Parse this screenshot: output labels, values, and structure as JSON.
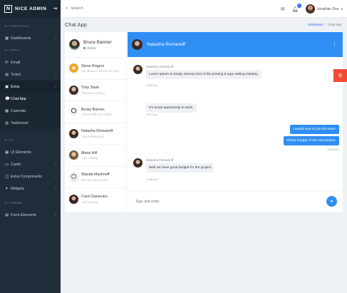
{
  "brand": {
    "name": "NICE ADMIN",
    "logo_letter": "N"
  },
  "sidebar": {
    "sections": {
      "personal": "PERSONAL",
      "apps": "APPS",
      "ui": "UI",
      "forms": "FORMS"
    },
    "items": {
      "dashboards": "Dashboards",
      "email": "Email",
      "ticket": "Ticket",
      "extra": "Extra",
      "chat_app": "Chat App",
      "calendar": "Calendar",
      "taskboard": "Taskboard",
      "ui_elements": "UI Elements",
      "cards": "Cards",
      "extra_components": "Extra Components",
      "widgets": "Widgets",
      "form_elements": "Form Elements"
    }
  },
  "topbar": {
    "search_placeholder": "Search",
    "notification_count": "3",
    "user_name": "Jonathan Doe"
  },
  "page": {
    "title": "Chat App",
    "breadcrumb": {
      "home": "Dashboard",
      "separator": "/",
      "current": "Chat App"
    }
  },
  "me": {
    "name": "Bruce Banner",
    "status": "Online"
  },
  "contacts": [
    {
      "name": "Steve Rogers",
      "message": "Hey Banner, Where are you?"
    },
    {
      "name": "Tony Stark",
      "message": "Thanos is coming"
    },
    {
      "name": "Bucky Barnes",
      "message": "I did not kill your family"
    },
    {
      "name": "Natasha Romanoff",
      "message": "I am multitasking"
    },
    {
      "name": "Maria Hill",
      "message": "I am coming"
    },
    {
      "name": "Wanda Maximoff",
      "message": "We have to go there"
    },
    {
      "name": "Carol Danevars",
      "message": "I am coming"
    }
  ],
  "conversation": {
    "name": "Natasha Romanoff",
    "messages": [
      {
        "sender": "Natasha Romanoff",
        "text": "Lorem Ipsum is simply dummy text of the printing & type setting industry.",
        "time": "10:56 am"
      },
      {
        "text": "It's Great opportunity to work.",
        "time": "10:57 am"
      },
      {
        "text": "I would love to join the team."
      },
      {
        "text": "Whats budget of the new project.",
        "time": "10:56 am"
      },
      {
        "sender": "Natasha Romanoff",
        "text": "Well we have good budget for the project",
        "time": "11:56 am"
      }
    ],
    "composer_placeholder": "Type and enter"
  },
  "colors": {
    "sidebar_bg": "#1f2d3a",
    "accent": "#2f8ef3",
    "settings_tab": "#f34a36",
    "online": "#2cb54b"
  }
}
